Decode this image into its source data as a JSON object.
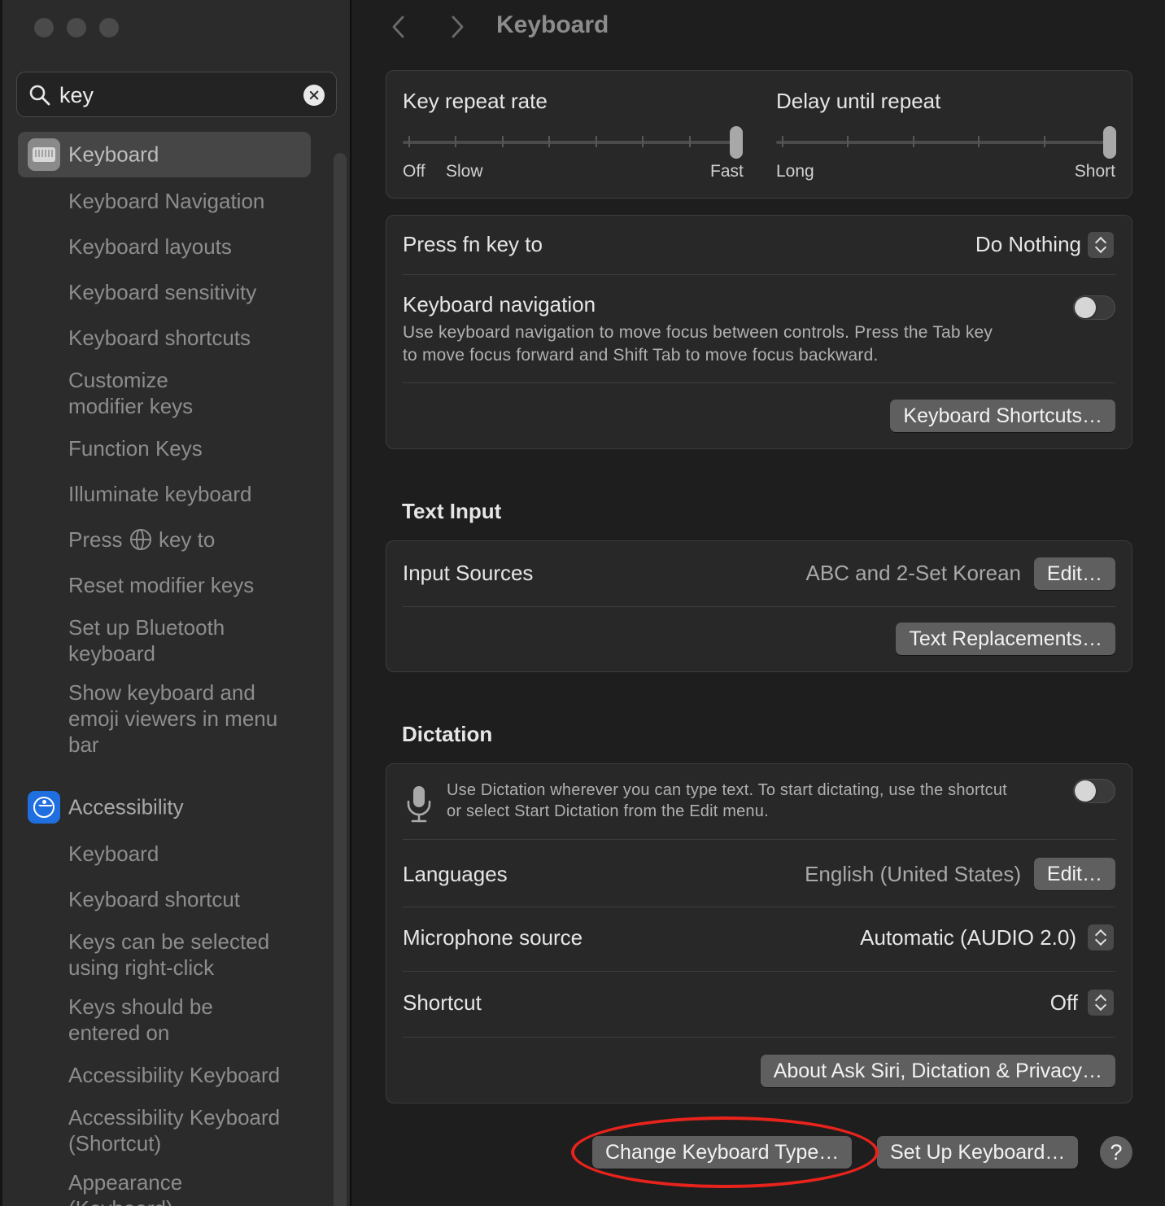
{
  "window": {
    "title": "Keyboard"
  },
  "search": {
    "value": "key"
  },
  "sidebar": {
    "groups": [
      {
        "label": "Keyboard",
        "icon": "keyboard-icon",
        "selected": true
      },
      {
        "label": "Accessibility",
        "icon": "accessibility-icon",
        "selected": false
      }
    ],
    "items": [
      "Keyboard Navigation",
      "Keyboard layouts",
      "Keyboard sensitivity",
      "Keyboard shortcuts",
      "Customize modifier keys",
      "Function Keys",
      "Illuminate keyboard",
      "Press",
      "key to",
      "Reset modifier keys",
      "Set up Bluetooth keyboard",
      "Show keyboard and emoji viewers in menu bar"
    ],
    "accessibility_items": [
      "Keyboard",
      "Keyboard shortcut",
      "Keys can be selected using right-click",
      "Keys should be entered on",
      "Accessibility Keyboard",
      "Accessibility Keyboard (Shortcut)",
      "Appearance (Keyboard)"
    ]
  },
  "repeat": {
    "key_repeat_rate": {
      "label": "Key repeat rate",
      "labels": [
        "Off",
        "Slow",
        "Fast"
      ],
      "ticks": 8,
      "level": 1.0
    },
    "delay_until_repeat": {
      "label": "Delay until repeat",
      "labels": [
        "Long",
        "Short"
      ],
      "ticks": 6,
      "level": 1.0
    }
  },
  "general": {
    "fn_label": "Press fn key to",
    "fn_value": "Do Nothing",
    "nav_label": "Keyboard navigation",
    "nav_desc_1": "Use keyboard navigation to move focus between controls. Press the Tab key",
    "nav_desc_2": "to move focus forward and Shift Tab to move focus backward.",
    "nav_on": false,
    "shortcuts_button": "Keyboard Shortcuts…"
  },
  "text_input": {
    "section": "Text Input",
    "sources_label": "Input Sources",
    "sources_value": "ABC and 2-Set Korean",
    "edit_button": "Edit…",
    "replacements_button": "Text Replacements…"
  },
  "dictation": {
    "section": "Dictation",
    "desc_1": "Use Dictation wherever you can type text. To start dictating, use the shortcut",
    "desc_2": "or select Start Dictation from the Edit menu.",
    "enabled": false,
    "languages_label": "Languages",
    "languages_value": "English (United States)",
    "edit_button": "Edit…",
    "mic_label": "Microphone source",
    "mic_value": "Automatic (AUDIO 2.0)",
    "shortcut_label": "Shortcut",
    "shortcut_value": "Off",
    "privacy_button": "About Ask Siri, Dictation & Privacy…"
  },
  "footer": {
    "change_type_button": "Change Keyboard Type…",
    "setup_button": "Set Up Keyboard…",
    "help_button": "?"
  },
  "colors": {
    "annotation": "#e8231c",
    "window_bg": "#1e1e1e",
    "sidebar_bg": "#2b2b2b"
  }
}
